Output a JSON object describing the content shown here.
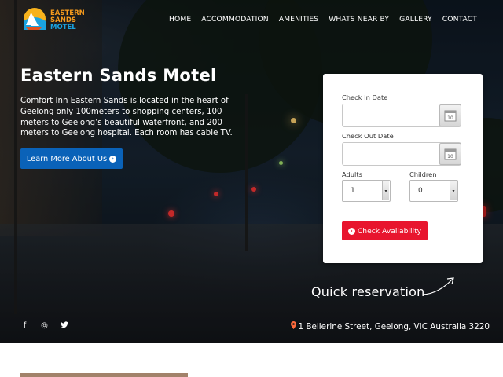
{
  "brand": {
    "logo_line1": "EASTERN",
    "logo_line2": "SANDS",
    "logo_line3": "MOTEL",
    "accent_orange": "#f59a1c",
    "accent_blue": "#1aa3e0"
  },
  "nav": {
    "items": [
      "HOME",
      "ACCOMMODATION",
      "AMENITIES",
      "WHATS NEAR BY",
      "GALLERY",
      "CONTACT"
    ]
  },
  "hero": {
    "title": "Eastern Sands Motel",
    "description": "Comfort Inn Eastern Sands is located in the heart of Geelong only 100meters to shopping centers, 100 meters to Geelong’s beautiful waterfront, and 200 meters to Geelong hospital. Each room has cable TV.",
    "button_label": "Learn More About Us",
    "button_color": "#0a62b8"
  },
  "booking": {
    "check_in_label": "Check In Date",
    "check_in_value": "",
    "check_out_label": "Check Out Date",
    "check_out_value": "",
    "calendar_day": "10",
    "adults_label": "Adults",
    "adults_value": "1",
    "children_label": "Children",
    "children_value": "0",
    "submit_label": "Check Availability",
    "submit_color": "#e8152e"
  },
  "quick_reservation": "Quick reservation",
  "social": {
    "facebook": "f",
    "instagram": "◎",
    "twitter": "🐦"
  },
  "address": "1 Bellerine Street, Geelong, VIC Australia 3220"
}
